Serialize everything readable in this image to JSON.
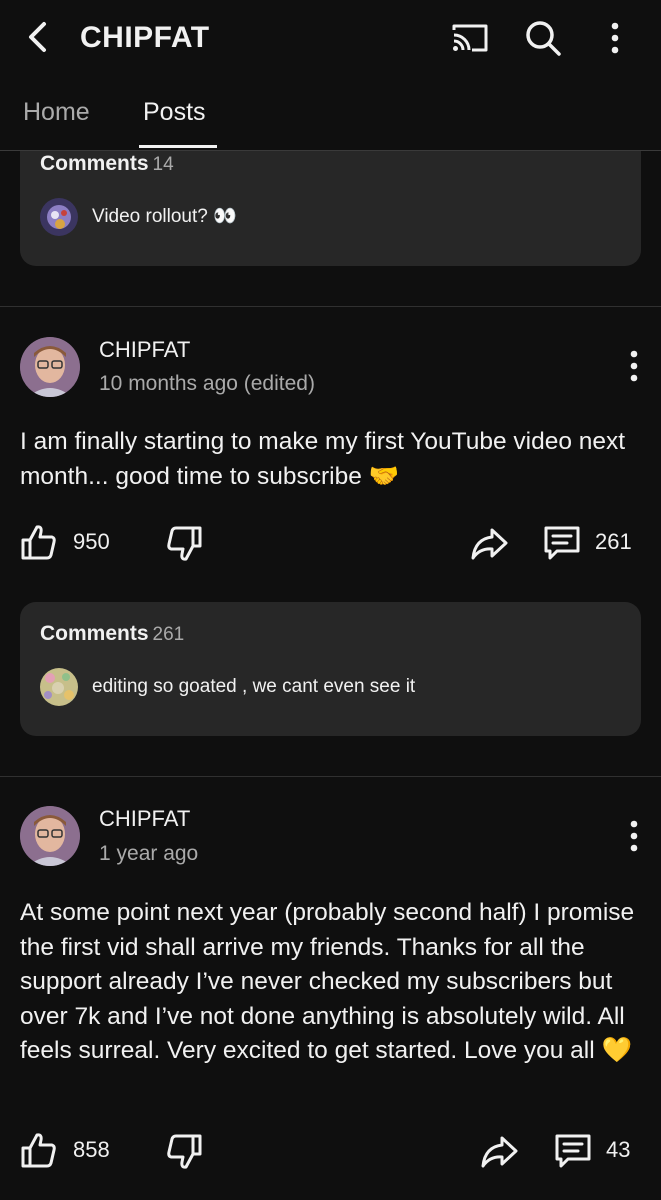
{
  "header": {
    "title": "CHIPFAT",
    "icons": [
      "back-arrow-icon",
      "cast-icon",
      "search-icon",
      "more-vertical-icon"
    ]
  },
  "tabs": [
    {
      "label": "Home",
      "selected": false
    },
    {
      "label": "Posts",
      "selected": true
    }
  ],
  "posts": [
    {
      "comments": {
        "label": "Comments",
        "count": "14",
        "top_comment": "Video rollout? 👀"
      }
    },
    {
      "author": "CHIPFAT",
      "time": "10 months ago (edited)",
      "text": "I am finally starting to make my first YouTube video next month... good time to subscribe 🤝",
      "likes": "950",
      "comment_count": "261",
      "comments": {
        "label": "Comments",
        "count": "261",
        "top_comment": "editing so goated , we cant even see it"
      }
    },
    {
      "author": "CHIPFAT",
      "time": "1 year ago",
      "text": "At some point next year (probably second half) I promise the first vid shall arrive my friends. Thanks for all the support already I’ve never checked my subscribers but over 7k and I’ve not done anything is absolutely wild. All feels surreal. Very excited to get started. Love you all 💛",
      "likes": "858",
      "comment_count": "43"
    }
  ],
  "colors": {
    "background": "#0f0f0f",
    "card": "#272727",
    "text": "#f1f1f1",
    "secondary_text": "#aaaaaa"
  }
}
